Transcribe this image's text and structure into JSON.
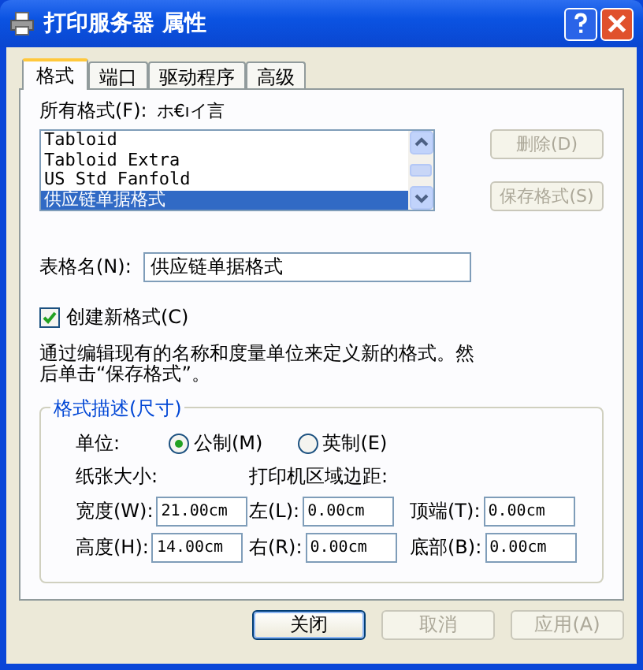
{
  "window": {
    "title": "打印服务器 属性"
  },
  "tabs": [
    {
      "label": "格式",
      "selected": true
    },
    {
      "label": "端口",
      "selected": false
    },
    {
      "label": "驱动程序",
      "selected": false
    },
    {
      "label": "高级",
      "selected": false
    }
  ],
  "forms_label": "所有格式(F):",
  "forms_label_extra": "ホ€ıイ言",
  "forms": [
    {
      "name": "Tabloid",
      "selected": false
    },
    {
      "name": "Tabloid Extra",
      "selected": false
    },
    {
      "name": "US Std Fanfold",
      "selected": false
    },
    {
      "name": "供应链单据格式",
      "selected": true
    }
  ],
  "list_buttons": [
    {
      "label": "删除(D)",
      "disabled": true
    },
    {
      "label": "保存格式(S)",
      "disabled": true
    }
  ],
  "form_name": {
    "label": "表格名(N):",
    "value": "供应链单据格式"
  },
  "create_new": {
    "label": "创建新格式(C)",
    "checked": true
  },
  "description": "通过编辑现有的名称和度量单位来定义新的格式。然后单击“保存格式”。",
  "group": {
    "title": "格式描述(尺寸)",
    "units_label": "单位:",
    "units": [
      {
        "label": "公制(M)",
        "selected": true
      },
      {
        "label": "英制(E)",
        "selected": false
      }
    ],
    "paper_size_label": "纸张大小:",
    "margins_label": "打印机区域边距:",
    "rows": [
      {
        "fields": [
          {
            "label": "宽度(W):",
            "value": "21.00cm"
          },
          {
            "label": "左(L):",
            "value": "0.00cm"
          },
          {
            "label": "顶端(T):",
            "value": "0.00cm"
          }
        ]
      },
      {
        "fields": [
          {
            "label": "高度(H):",
            "value": "14.00cm"
          },
          {
            "label": "右(R):",
            "value": "0.00cm"
          },
          {
            "label": "底部(B):",
            "value": "0.00cm"
          }
        ]
      }
    ]
  },
  "buttons": [
    {
      "label": "关闭",
      "disabled": false,
      "default": true
    },
    {
      "label": "取消",
      "disabled": true,
      "default": false
    },
    {
      "label": "应用(A)",
      "disabled": true,
      "default": false
    }
  ]
}
